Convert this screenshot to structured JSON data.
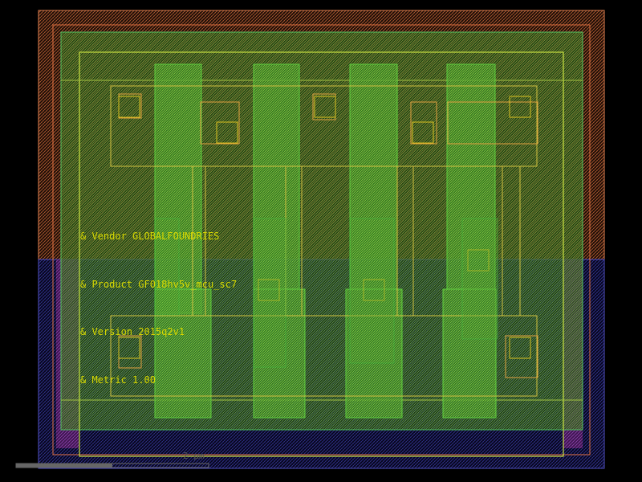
{
  "cell_labels": {
    "vendor": "& Vendor GLOBALFOUNDRIES",
    "product": "& Product GF018hv5v_mcu_sc7",
    "version": "& Version 2015q2v1",
    "metric": "& Metric 1.00"
  },
  "scale_bar": {
    "label": "2 μm"
  },
  "colors": {
    "background": "#000000",
    "nwell": "#e07040",
    "pwell": "#4040c0",
    "diffusion": "#40c040",
    "poly": "#c8d040",
    "metal": "#e0b040",
    "text": "#d8d800",
    "implant": "#c040c0"
  }
}
